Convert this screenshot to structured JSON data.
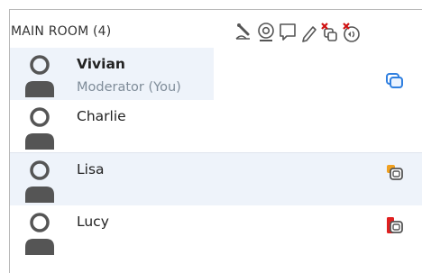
{
  "room": {
    "title": "MAIN ROOM (4)"
  },
  "toolbar": {
    "icons": [
      "microphone-muted-icon",
      "webcam-icon",
      "chat-icon",
      "pencil-icon",
      "screen-share-disabled-icon",
      "sound-disabled-icon"
    ]
  },
  "participants": [
    {
      "name": "Vivian",
      "role": "Moderator (You)",
      "status_icon": "screen-share-blue-icon"
    },
    {
      "name": "Charlie",
      "role": "",
      "status_icon": ""
    },
    {
      "name": "Lisa",
      "role": "",
      "status_icon": "screen-share-orange-icon"
    },
    {
      "name": "Lucy",
      "role": "",
      "status_icon": "screen-share-red-icon"
    }
  ],
  "colors": {
    "row_highlight": "#eef3fa",
    "role_text": "#7f8c99",
    "icon_blue": "#2f7fe0",
    "icon_orange": "#f0a020",
    "icon_red": "#e02020"
  }
}
